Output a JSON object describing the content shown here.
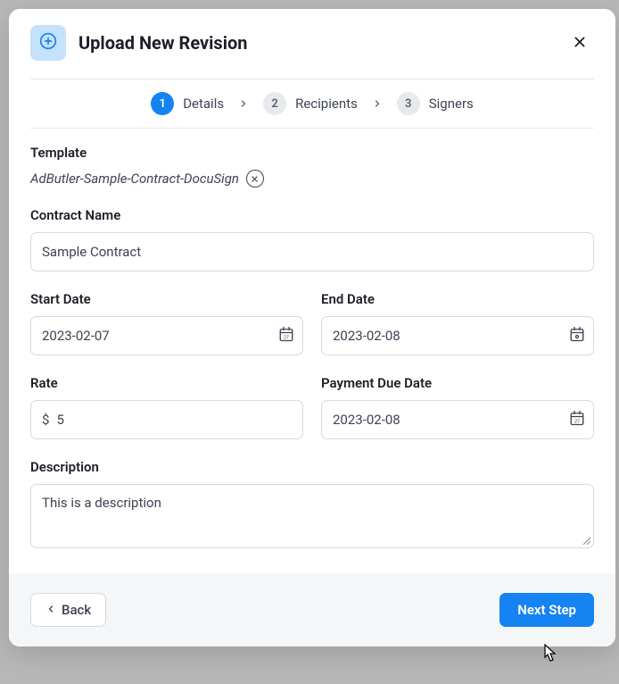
{
  "header": {
    "title": "Upload New Revision"
  },
  "stepper": {
    "steps": [
      {
        "num": "1",
        "label": "Details",
        "active": true
      },
      {
        "num": "2",
        "label": "Recipients",
        "active": false
      },
      {
        "num": "3",
        "label": "Signers",
        "active": false
      }
    ]
  },
  "template": {
    "label": "Template",
    "name": "AdButler-Sample-Contract-DocuSign"
  },
  "fields": {
    "contract_name": {
      "label": "Contract Name",
      "value": "Sample Contract"
    },
    "start_date": {
      "label": "Start Date",
      "value": "2023-02-07"
    },
    "end_date": {
      "label": "End Date",
      "value": "2023-02-08"
    },
    "rate": {
      "label": "Rate",
      "prefix": "$",
      "value": "5"
    },
    "payment_due": {
      "label": "Payment Due Date",
      "value": "2023-02-08"
    },
    "description": {
      "label": "Description",
      "value": "This is a description"
    }
  },
  "footer": {
    "back_label": "Back",
    "next_label": "Next Step"
  }
}
